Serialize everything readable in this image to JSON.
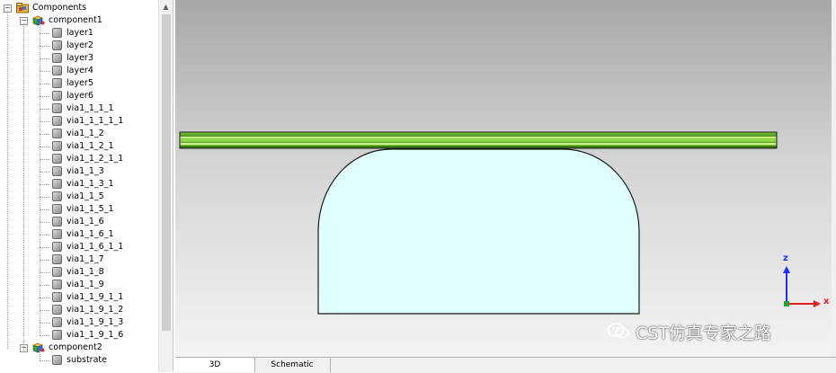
{
  "tree": {
    "root": "Components",
    "component1": {
      "label": "component1",
      "children": [
        "layer1",
        "layer2",
        "layer3",
        "layer4",
        "layer5",
        "layer6",
        "via1_1_1_1",
        "via1_1_1_1_1",
        "via1_1_2",
        "via1_1_2_1",
        "via1_1_2_1_1",
        "via1_1_3",
        "via1_1_3_1",
        "via1_1_5",
        "via1_1_5_1",
        "via1_1_6",
        "via1_1_6_1",
        "via1_1_6_1_1",
        "via1_1_7",
        "via1_1_8",
        "via1_1_9",
        "via1_1_9_1_1",
        "via1_1_9_1_2",
        "via1_1_9_1_3",
        "via1_1_9_1_6"
      ]
    },
    "component2": {
      "label": "component2",
      "children": [
        "substrate"
      ]
    },
    "expander_collapse": "⊟"
  },
  "viewport": {
    "axes": {
      "z_label": "z",
      "x_label": "x",
      "z_color": "#1f2cff",
      "x_color": "#e02020"
    },
    "colors": {
      "board_green": "#8cd63c",
      "board_dark": "#2d5f0c",
      "body_fill": "#e0ffff"
    }
  },
  "tabs": [
    {
      "label": "3D",
      "active": true
    },
    {
      "label": "Schematic",
      "active": false
    }
  ],
  "watermark": "CST仿真专家之路"
}
